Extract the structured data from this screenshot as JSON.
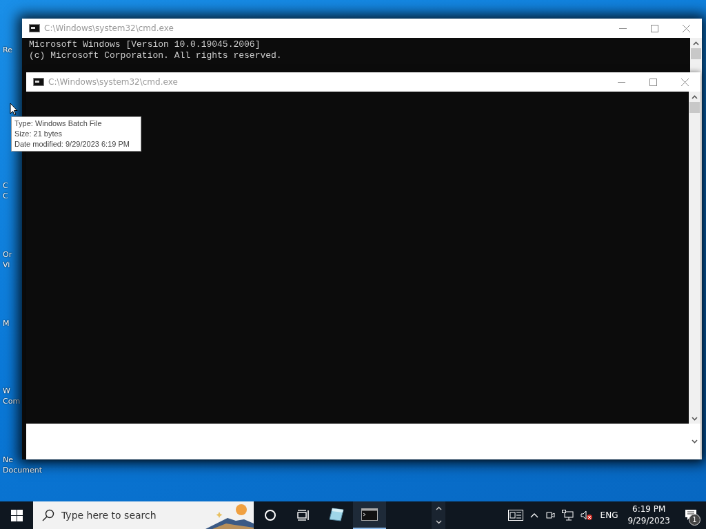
{
  "desktop_icons": [
    {
      "lines": [
        "Re"
      ]
    },
    {
      "lines": [
        "C",
        "C"
      ]
    },
    {
      "lines": [
        "Or",
        "Vi"
      ]
    },
    {
      "lines": [
        "M"
      ]
    },
    {
      "lines": [
        "W",
        "Com"
      ]
    },
    {
      "lines": [
        "Ne",
        "Document"
      ]
    }
  ],
  "windows": [
    {
      "title": "C:\\Windows\\system32\\cmd.exe",
      "lines": [
        "Microsoft Windows [Version 10.0.19045.2006]",
        "(c) Microsoft Corporation. All rights reserved."
      ]
    },
    {
      "title": "C:\\Windows\\system32\\cmd.exe"
    }
  ],
  "tooltip": {
    "lines": [
      "Type: Windows Batch File",
      "Size: 21 bytes",
      "Date modified: 9/29/2023 6:19 PM"
    ]
  },
  "taskbar": {
    "search": {
      "placeholder": "Type here to search"
    },
    "apps": [
      {
        "kind": "notepad",
        "running": false
      },
      {
        "kind": "console",
        "running": true
      }
    ],
    "language": "ENG",
    "time": "6:19 PM",
    "date": "9/29/2023",
    "notification_count": "1"
  }
}
